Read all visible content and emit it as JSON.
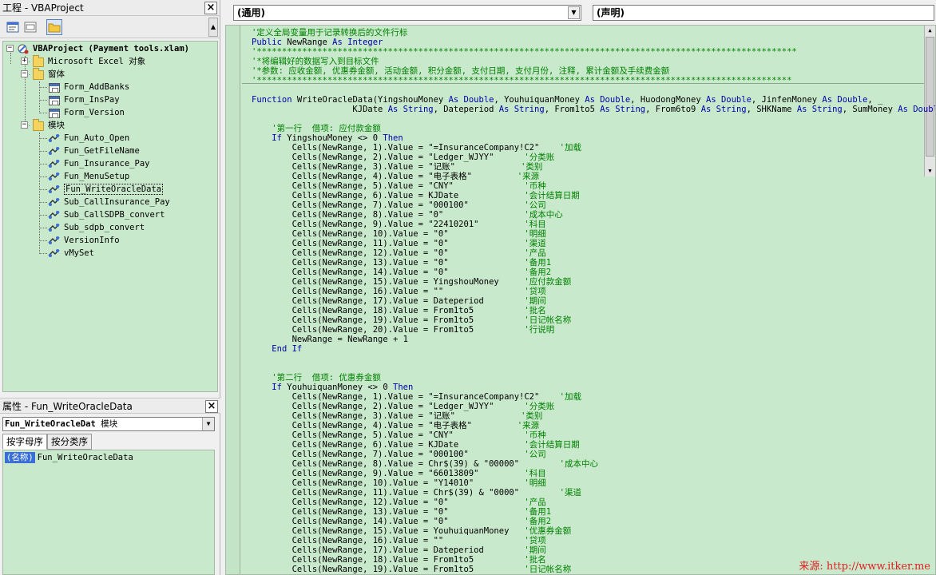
{
  "project_panel": {
    "title": "工程 - VBAProject",
    "root": "VBAProject (Payment tools.xlam)",
    "excel_objects": "Microsoft Excel 对象",
    "forms_folder": "窗体",
    "forms": [
      "Form_AddBanks",
      "Form_InsPay",
      "Form_Version"
    ],
    "modules_folder": "模块",
    "modules": [
      "Fun_Auto_Open",
      "Fun_GetFileName",
      "Fun_Insurance_Pay",
      "Fun_MenuSetup",
      "Fun_WriteOracleData",
      "Sub_CallInsurance_Pay",
      "Sub_CallSDPB_convert",
      "Sub_sdpb_convert",
      "VersionInfo",
      "vMySet"
    ],
    "selected_module": "Fun_WriteOracleData"
  },
  "properties_panel": {
    "title": "属性 - Fun_WriteOracleData",
    "object_name": "Fun_WriteOracleDat",
    "object_type": "模块",
    "tabs": [
      "按字母序",
      "按分类序"
    ],
    "prop_name": "(名称)",
    "prop_value": "Fun_WriteOracleData"
  },
  "code_window": {
    "object_dropdown": "(通用)",
    "proc_dropdown": "(声明)",
    "watermark": "来源: http://www.itker.me",
    "header_lines": [
      [
        [
          "cm",
          "'定义全局变量用于记录转换后的文件行标"
        ]
      ],
      [
        [
          "kw",
          "Public "
        ],
        [
          "",
          "NewRange "
        ],
        [
          "kw",
          "As Integer"
        ]
      ],
      [
        [
          "cm",
          "'***********************************************************************************************************"
        ]
      ],
      [
        [
          "cm",
          "'*将编辑好的数据写入到目标文件"
        ]
      ],
      [
        [
          "cm",
          "'*参数: 应收金额, 优惠券金额, 活动金额, 积分金额, 支付日期, 支付月份, 注释, 累计金额及手续费金额"
        ]
      ],
      [
        [
          "cm",
          "'**********************************************************************************************************"
        ]
      ]
    ],
    "body_lines": [
      [
        [
          "kw",
          "Function "
        ],
        [
          "",
          "WriteOracleData(YingshouMoney "
        ],
        [
          "kw",
          "As Double"
        ],
        [
          "",
          ", YouhuiquanMoney "
        ],
        [
          "kw",
          "As Double"
        ],
        [
          "",
          ", HuodongMoney "
        ],
        [
          "kw",
          "As Double"
        ],
        [
          "",
          ", JinfenMoney "
        ],
        [
          "kw",
          "As Double"
        ],
        [
          "",
          ", _"
        ]
      ],
      [
        [
          "",
          "                    KJDate "
        ],
        [
          "kw",
          "As String"
        ],
        [
          "",
          ", Dateperiod "
        ],
        [
          "kw",
          "As String"
        ],
        [
          "",
          ", From1to5 "
        ],
        [
          "kw",
          "As String"
        ],
        [
          "",
          ", From6to9 "
        ],
        [
          "kw",
          "As String"
        ],
        [
          "",
          ", SHKName "
        ],
        [
          "kw",
          "As String"
        ],
        [
          "",
          ", SumMoney "
        ],
        [
          "kw",
          "As Double"
        ],
        [
          "",
          ","
        ]
      ],
      [],
      [
        [
          "",
          "    "
        ],
        [
          "cm",
          "'第一行  借项: 应付款金额"
        ]
      ],
      [
        [
          "",
          "    "
        ],
        [
          "kw",
          "If "
        ],
        [
          "",
          "YingshouMoney <> 0 "
        ],
        [
          "kw",
          "Then"
        ]
      ],
      [
        [
          "",
          "        Cells(NewRange, 1).Value = \"=InsuranceCompany!C2\"    "
        ],
        [
          "cm",
          "'加载"
        ]
      ],
      [
        [
          "",
          "        Cells(NewRange, 2).Value = \"Ledger_WJYY\"      "
        ],
        [
          "cm",
          "'分类账"
        ]
      ],
      [
        [
          "",
          "        Cells(NewRange, 3).Value = \"记账\"             "
        ],
        [
          "cm",
          "'类别"
        ]
      ],
      [
        [
          "",
          "        Cells(NewRange, 4).Value = \"电子表格\"         "
        ],
        [
          "cm",
          "'来源"
        ]
      ],
      [
        [
          "",
          "        Cells(NewRange, 5).Value = \"CNY\"              "
        ],
        [
          "cm",
          "'币种"
        ]
      ],
      [
        [
          "",
          "        Cells(NewRange, 6).Value = KJDate             "
        ],
        [
          "cm",
          "'会计结算日期"
        ]
      ],
      [
        [
          "",
          "        Cells(NewRange, 7).Value = \"000100\"           "
        ],
        [
          "cm",
          "'公司"
        ]
      ],
      [
        [
          "",
          "        Cells(NewRange, 8).Value = \"0\"                "
        ],
        [
          "cm",
          "'成本中心"
        ]
      ],
      [
        [
          "",
          "        Cells(NewRange, 9).Value = \"22410201\"         "
        ],
        [
          "cm",
          "'科目"
        ]
      ],
      [
        [
          "",
          "        Cells(NewRange, 10).Value = \"0\"               "
        ],
        [
          "cm",
          "'明细"
        ]
      ],
      [
        [
          "",
          "        Cells(NewRange, 11).Value = \"0\"               "
        ],
        [
          "cm",
          "'渠道"
        ]
      ],
      [
        [
          "",
          "        Cells(NewRange, 12).Value = \"0\"               "
        ],
        [
          "cm",
          "'产品"
        ]
      ],
      [
        [
          "",
          "        Cells(NewRange, 13).Value = \"0\"               "
        ],
        [
          "cm",
          "'备用1"
        ]
      ],
      [
        [
          "",
          "        Cells(NewRange, 14).Value = \"0\"               "
        ],
        [
          "cm",
          "'备用2"
        ]
      ],
      [
        [
          "",
          "        Cells(NewRange, 15).Value = YingshouMoney     "
        ],
        [
          "cm",
          "'应付款金额"
        ]
      ],
      [
        [
          "",
          "        Cells(NewRange, 16).Value = \"\"                "
        ],
        [
          "cm",
          "'贷项"
        ]
      ],
      [
        [
          "",
          "        Cells(NewRange, 17).Value = Dateperiod        "
        ],
        [
          "cm",
          "'期间"
        ]
      ],
      [
        [
          "",
          "        Cells(NewRange, 18).Value = From1to5          "
        ],
        [
          "cm",
          "'批名"
        ]
      ],
      [
        [
          "",
          "        Cells(NewRange, 19).Value = From1to5          "
        ],
        [
          "cm",
          "'日记帐名称"
        ]
      ],
      [
        [
          "",
          "        Cells(NewRange, 20).Value = From1to5          "
        ],
        [
          "cm",
          "'行说明"
        ]
      ],
      [
        [
          "",
          "        NewRange = NewRange + 1"
        ]
      ],
      [
        [
          "",
          "    "
        ],
        [
          "kw",
          "End If"
        ]
      ],
      [],
      [],
      [
        [
          "",
          "    "
        ],
        [
          "cm",
          "'第二行  借项: 优惠券金额"
        ]
      ],
      [
        [
          "",
          "    "
        ],
        [
          "kw",
          "If "
        ],
        [
          "",
          "YouhuiquanMoney <> 0 "
        ],
        [
          "kw",
          "Then"
        ]
      ],
      [
        [
          "",
          "        Cells(NewRange, 1).Value = \"=InsuranceCompany!C2\"    "
        ],
        [
          "cm",
          "'加载"
        ]
      ],
      [
        [
          "",
          "        Cells(NewRange, 2).Value = \"Ledger_WJYY\"      "
        ],
        [
          "cm",
          "'分类账"
        ]
      ],
      [
        [
          "",
          "        Cells(NewRange, 3).Value = \"记账\"             "
        ],
        [
          "cm",
          "'类别"
        ]
      ],
      [
        [
          "",
          "        Cells(NewRange, 4).Value = \"电子表格\"         "
        ],
        [
          "cm",
          "'来源"
        ]
      ],
      [
        [
          "",
          "        Cells(NewRange, 5).Value = \"CNY\"              "
        ],
        [
          "cm",
          "'币种"
        ]
      ],
      [
        [
          "",
          "        Cells(NewRange, 6).Value = KJDate             "
        ],
        [
          "cm",
          "'会计结算日期"
        ]
      ],
      [
        [
          "",
          "        Cells(NewRange, 7).Value = \"000100\"           "
        ],
        [
          "cm",
          "'公司"
        ]
      ],
      [
        [
          "",
          "        Cells(NewRange, 8).Value = Chr$(39) & \"00000\"        "
        ],
        [
          "cm",
          "'成本中心"
        ]
      ],
      [
        [
          "",
          "        Cells(NewRange, 9).Value = \"66013809\"         "
        ],
        [
          "cm",
          "'科目"
        ]
      ],
      [
        [
          "",
          "        Cells(NewRange, 10).Value = \"Y14010\"          "
        ],
        [
          "cm",
          "'明细"
        ]
      ],
      [
        [
          "",
          "        Cells(NewRange, 11).Value = Chr$(39) & \"0000\"        "
        ],
        [
          "cm",
          "'渠道"
        ]
      ],
      [
        [
          "",
          "        Cells(NewRange, 12).Value = \"0\"               "
        ],
        [
          "cm",
          "'产品"
        ]
      ],
      [
        [
          "",
          "        Cells(NewRange, 13).Value = \"0\"               "
        ],
        [
          "cm",
          "'备用1"
        ]
      ],
      [
        [
          "",
          "        Cells(NewRange, 14).Value = \"0\"               "
        ],
        [
          "cm",
          "'备用2"
        ]
      ],
      [
        [
          "",
          "        Cells(NewRange, 15).Value = YouhuiquanMoney   "
        ],
        [
          "cm",
          "'优惠券金额"
        ]
      ],
      [
        [
          "",
          "        Cells(NewRange, 16).Value = \"\"                "
        ],
        [
          "cm",
          "'贷项"
        ]
      ],
      [
        [
          "",
          "        Cells(NewRange, 17).Value = Dateperiod        "
        ],
        [
          "cm",
          "'期间"
        ]
      ],
      [
        [
          "",
          "        Cells(NewRange, 18).Value = From1to5          "
        ],
        [
          "cm",
          "'批名"
        ]
      ],
      [
        [
          "",
          "        Cells(NewRange, 19).Value = From1to5          "
        ],
        [
          "cm",
          "'日记帐名称"
        ]
      ]
    ]
  }
}
